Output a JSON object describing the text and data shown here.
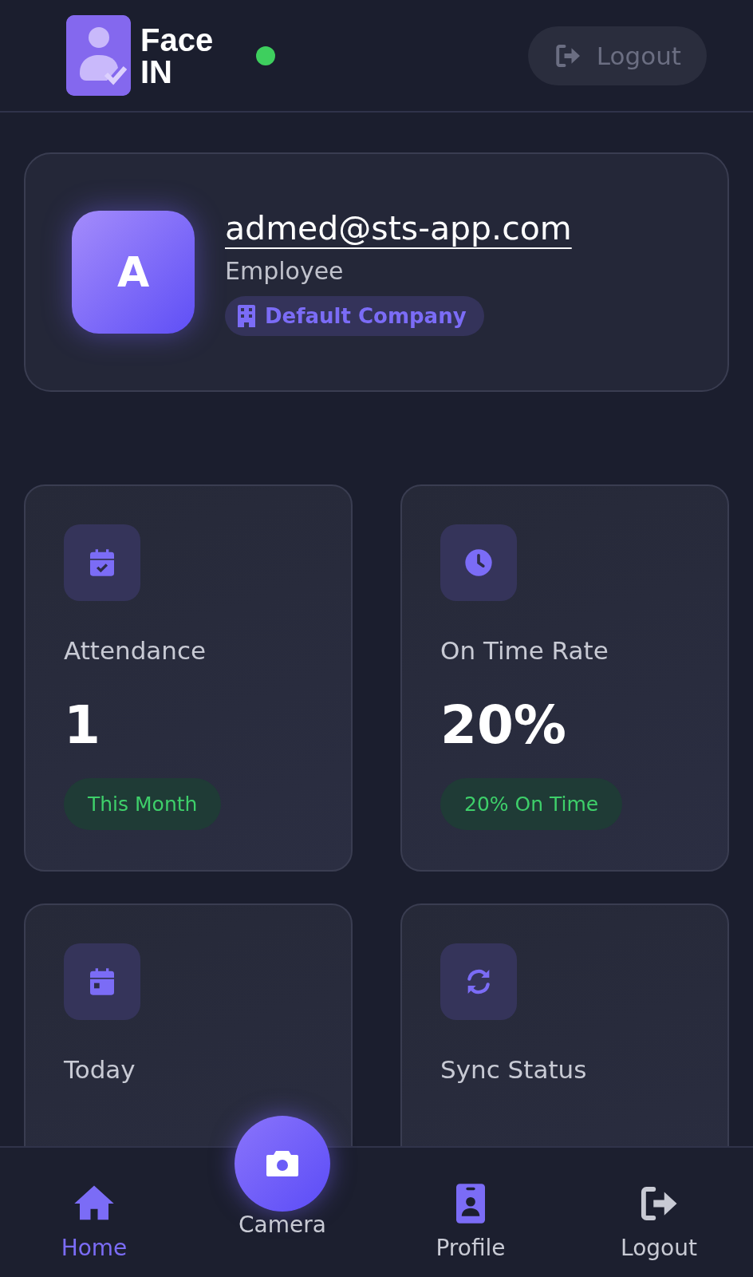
{
  "header": {
    "logo": {
      "line_1": "Face",
      "line_2": "IN"
    },
    "connected": true,
    "logout_button": {
      "label": "Logout",
      "disabled": true
    }
  },
  "profile": {
    "avatar_letter": "A",
    "email": "admed@sts-app.com",
    "role": "Employee",
    "company": "Default Company"
  },
  "stats": [
    {
      "label": "Attendance",
      "value": "1",
      "badge": "This Month"
    },
    {
      "label": "On Time Rate",
      "value": "20%",
      "badge": "20% On Time"
    },
    {
      "label": "Today"
    },
    {
      "label": "Sync Status"
    }
  ],
  "bottom_nav": [
    {
      "label": "Home",
      "selected": true,
      "kind": "tab"
    },
    {
      "label": "Camera",
      "selected": false,
      "kind": "raised"
    },
    {
      "label": "Profile",
      "selected": false,
      "kind": "tab"
    },
    {
      "label": "Logout",
      "selected": false,
      "kind": "tab"
    }
  ]
}
